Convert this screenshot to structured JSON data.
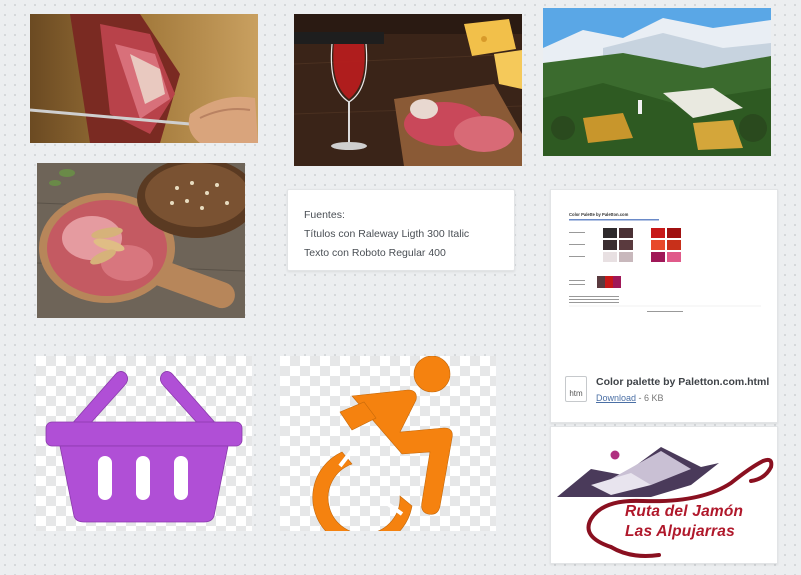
{
  "board": {
    "images": [
      {
        "name": "ham-slicing-photo"
      },
      {
        "name": "wine-cheese-ham-photo"
      },
      {
        "name": "alpujarras-village-photo"
      },
      {
        "name": "ham-board-bread-photo"
      }
    ]
  },
  "note": {
    "lines": [
      "Fuentes:",
      "Títulos con Raleway Ligth 300 Italic",
      "Texto con Roboto Regular 400"
    ]
  },
  "file": {
    "icon_label": "htm",
    "name": "Color palette by Paletton.com.html",
    "download_label": "Download",
    "size": " - 6 KB",
    "preview_title": "Color Palette by Paletton.com"
  },
  "icons": {
    "basket_color": "#b04fd6",
    "wheelchair_color": "#f5820f"
  },
  "logo": {
    "line1": "Ruta del Jamón",
    "line2": "Las Alpujarras",
    "text_color": "#b0182b"
  }
}
